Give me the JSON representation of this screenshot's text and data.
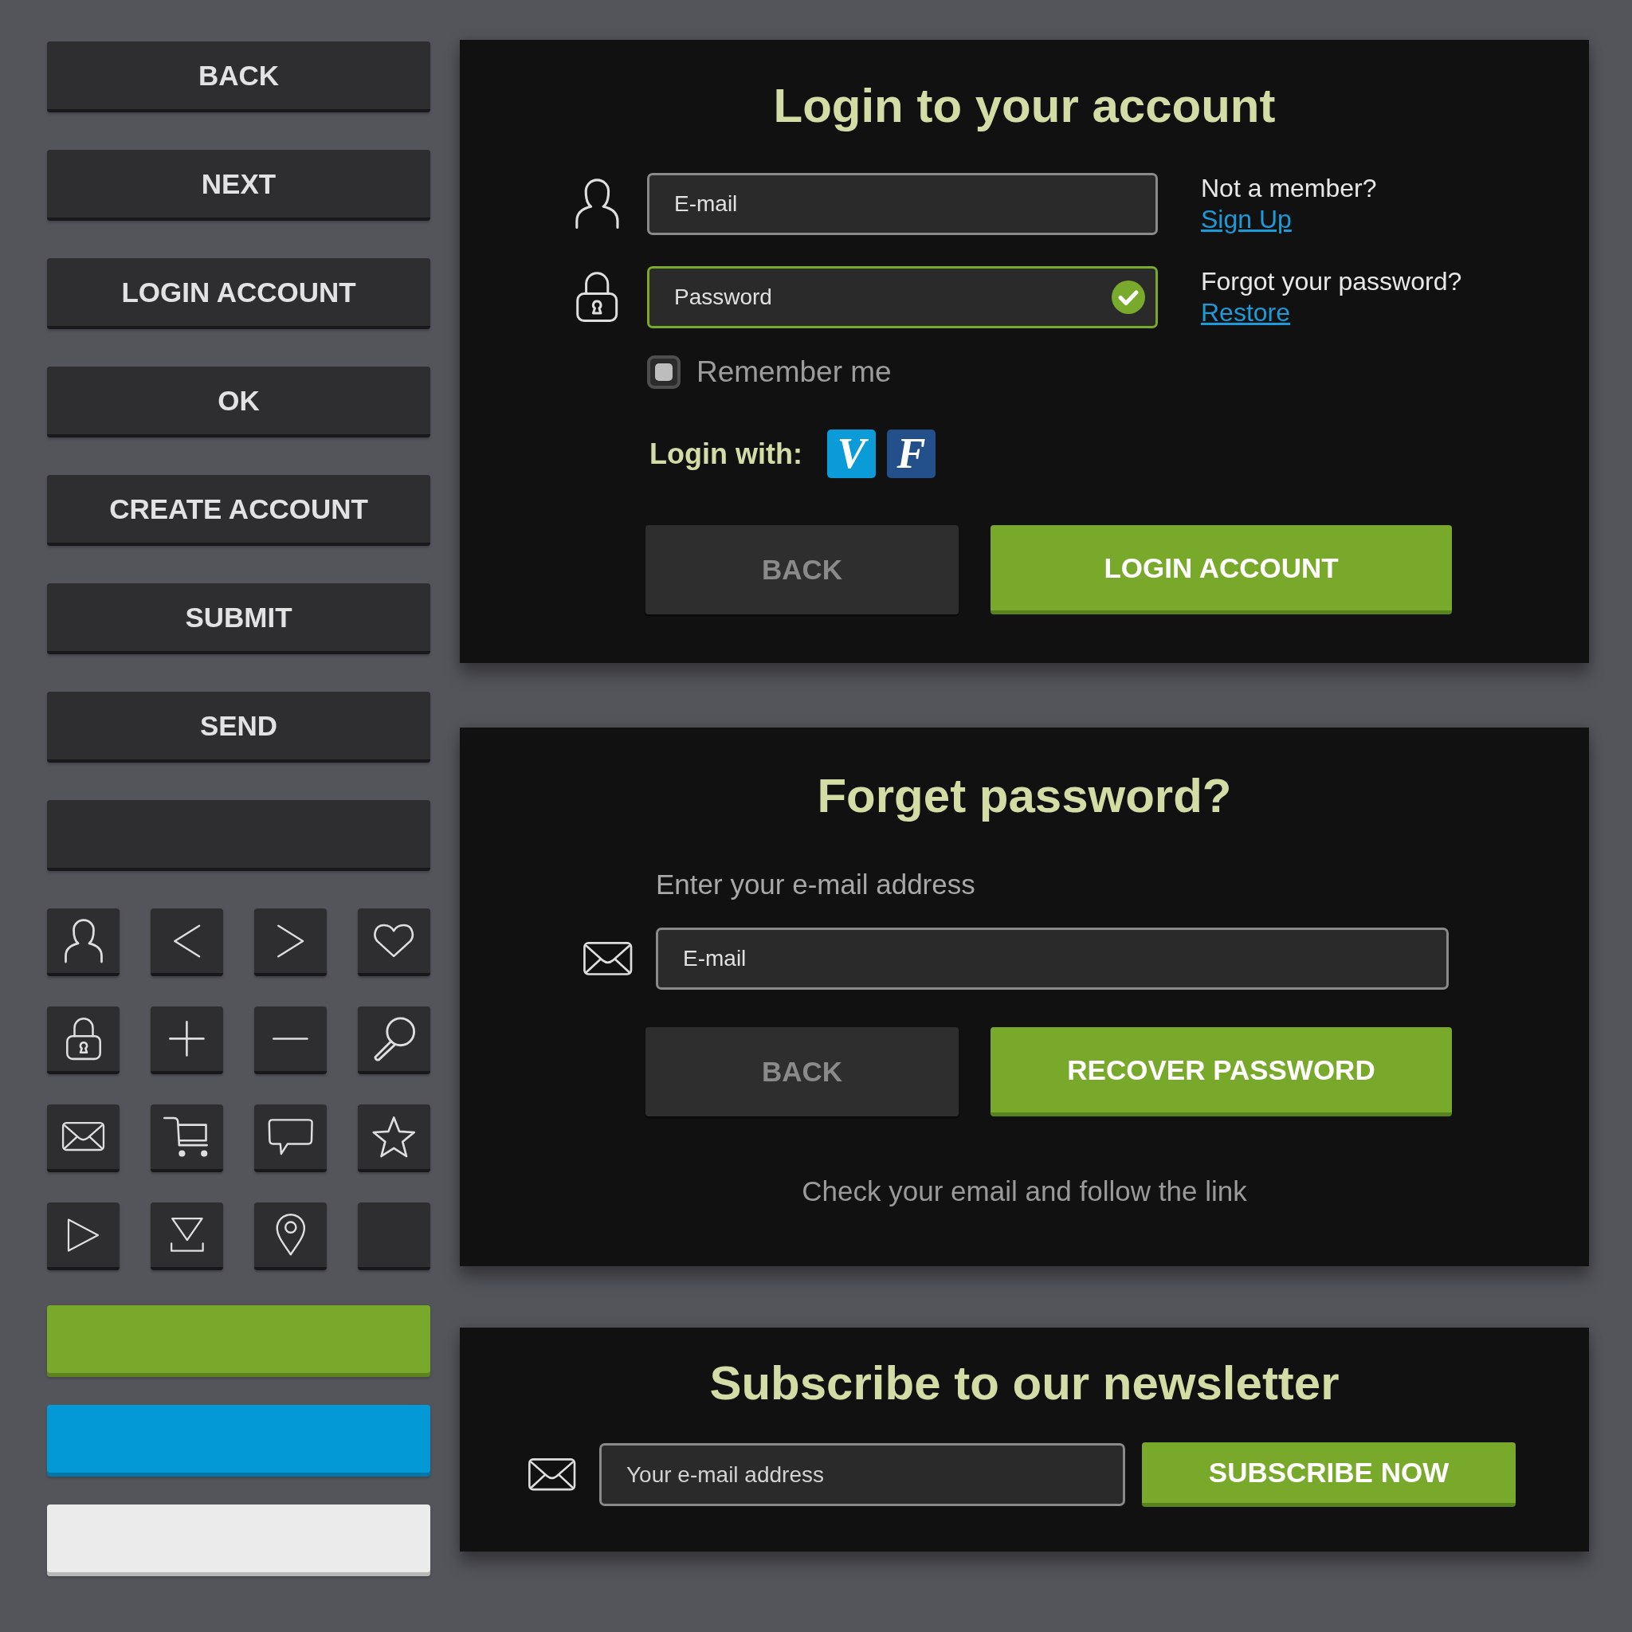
{
  "side_buttons": [
    {
      "kind": "text",
      "label": "BACK"
    },
    {
      "kind": "text",
      "label": "NEXT"
    },
    {
      "kind": "text",
      "label": "LOGIN ACCOUNT"
    },
    {
      "kind": "text",
      "label": "OK"
    },
    {
      "kind": "text",
      "label": "CREATE ACCOUNT"
    },
    {
      "kind": "text",
      "label": "SUBMIT"
    },
    {
      "kind": "text",
      "label": "SEND"
    },
    {
      "kind": "blank"
    }
  ],
  "color_buttons": [
    {
      "color": "#78a92b"
    },
    {
      "color": "#0398d6"
    },
    {
      "color": "#ebebeb"
    }
  ],
  "login_panel": {
    "title": "Login to your account",
    "fields": [
      {
        "kind": "email",
        "placeholder": "E-mail",
        "valid": false,
        "note": "Not a member?",
        "link": "Sign Up"
      },
      {
        "kind": "password",
        "placeholder": "Password",
        "valid": true,
        "note": "Forgot your password?",
        "link": "Restore"
      }
    ],
    "remember": {
      "label": "Remember me",
      "checked": false
    },
    "login_with": {
      "label": "Login with:",
      "providers": [
        {
          "letter": "V",
          "color": "#0a9bd8"
        },
        {
          "letter": "F",
          "color": "#234f8a"
        }
      ]
    },
    "buttons": [
      {
        "kind": "secondary",
        "label": "BACK"
      },
      {
        "kind": "primary",
        "label": "LOGIN ACCOUNT"
      }
    ]
  },
  "forgot_panel": {
    "title": "Forget password?",
    "prompt": "Enter your e-mail address",
    "field": {
      "placeholder": "E-mail"
    },
    "buttons": [
      {
        "kind": "secondary",
        "label": "BACK"
      },
      {
        "kind": "primary",
        "label": "RECOVER PASSWORD"
      }
    ],
    "note": "Check your email and follow the link"
  },
  "newsletter_panel": {
    "title": "Subscribe to our newsletter",
    "field": {
      "placeholder": "Your e-mail address"
    },
    "button": {
      "kind": "primary",
      "label": "SUBSCRIBE NOW"
    }
  }
}
